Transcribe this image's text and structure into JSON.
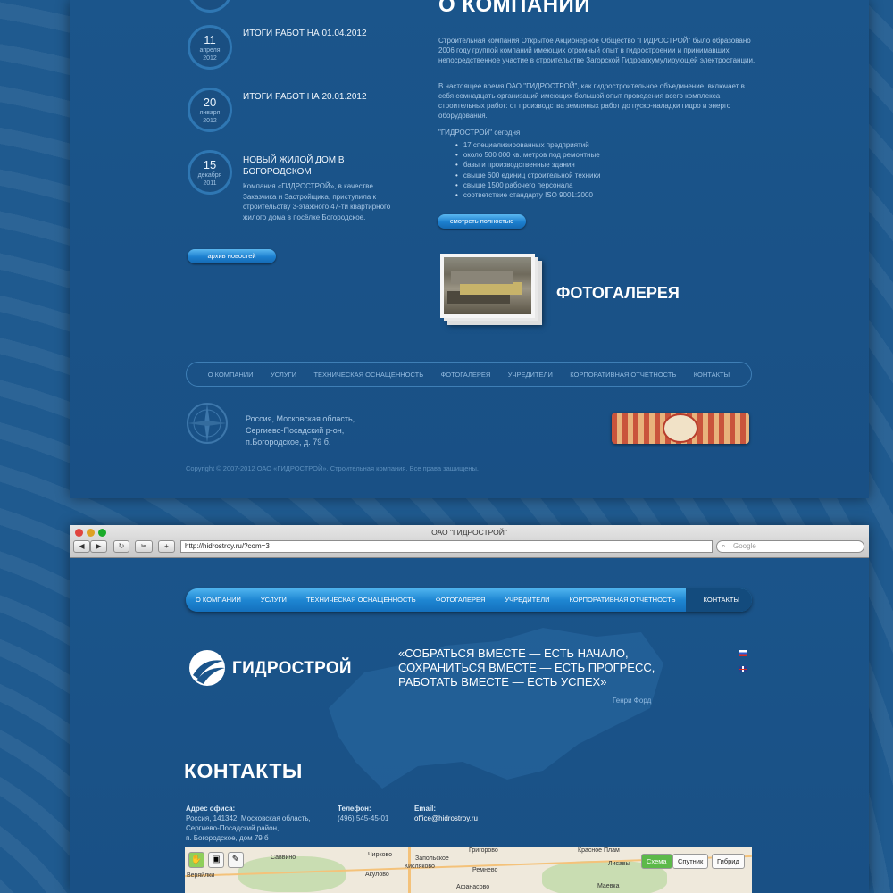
{
  "news": [
    {
      "day": "11",
      "month": "апреля",
      "year": "2012",
      "title": "ИТОГИ РАБОТ НА 01.04.2012",
      "text": ""
    },
    {
      "day": "20",
      "month": "января",
      "year": "2012",
      "title": "ИТОГИ РАБОТ НА 20.01.2012",
      "text": ""
    },
    {
      "day": "15",
      "month": "декабря",
      "year": "2011",
      "title": "НОВЫЙ ЖИЛОЙ ДОМ В БОГОРОДСКОМ",
      "text": "Компания «ГИДРОСТРОЙ», в качестве Заказчика и Застройщика, приступила к строительству 3-этажного 47-ти квартирного жилого дома в посёлке Богородское."
    }
  ],
  "news_archive_button": "архив новостей",
  "about": {
    "title": "О КОМПАНИИ",
    "p1": "Строительная компания Открытое Акционерное Общество \"ГИДРОСТРОЙ\" было образовано 2006 году группой компаний имеющих огромный опыт в гидростроении и принимавших непосредственное участие в строительстве Загорской Гидроаккумулирующей электростанции.",
    "p2": "В настоящее время ОАО \"ГИДРОСТРОЙ\", как гидростроительное объединение, включает в себя семнадцать организаций имеющих большой опыт проведения всего комплекса строительных работ: от производства земляных работ до пуско-наладки гидро и энерго оборудования.",
    "today": "\"ГИДРОСТРОЙ\" сегодня",
    "list": [
      "17 специализированных предприятий",
      "около 500 000 кв. метров под ремонтные",
      "базы и производственные здания",
      "свыше 600 единиц строительной техники",
      "свыше 1500 рабочего персонала",
      "соответствие стандарту ISO 9001:2000"
    ],
    "more_button": "смотреть полностью"
  },
  "gallery_label": "ФОТОГАЛЕРЕЯ",
  "footer_nav": [
    "О КОМПАНИИ",
    "УСЛУГИ",
    "ТЕХНИЧЕСКАЯ ОСНАЩЕННОСТЬ",
    "ФОТОГАЛЕРЕЯ",
    "УЧРЕДИТЕЛИ",
    "КОРПОРАТИВНАЯ ОТЧЕТНОСТЬ",
    "КОНТАКТЫ"
  ],
  "footer_address": [
    "Россия, Московская область,",
    "Сергиево-Посадский р-он,",
    "п.Богородское, д. 79 б."
  ],
  "copyright": "Copyright © 2007-2012 ОАО «ГИДРОСТРОЙ». Строительная компания. Все права защищены.",
  "browser": {
    "title": "ОАО \"ГИДРОСТРОЙ\"",
    "url": "http://hidrostroy.ru/?com=3",
    "search_placeholder": "Google"
  },
  "site_nav": [
    "О КОМПАНИИ",
    "УСЛУГИ",
    "ТЕХНИЧЕСКАЯ ОСНАЩЕННОСТЬ",
    "ФОТОГАЛЕРЕЯ",
    "УЧРЕДИТЕЛИ",
    "КОРПОРАТИВНАЯ ОТЧЕТНОСТЬ",
    "КОНТАКТЫ"
  ],
  "logo_text": "ГИДРОСТРОЙ",
  "quote": [
    "«СОБРАТЬСЯ ВМЕСТЕ — ЕСТЬ НАЧАЛО,",
    "СОХРАНИТЬСЯ ВМЕСТЕ — ЕСТЬ ПРОГРЕСС,",
    "РАБОТАТЬ ВМЕСТЕ — ЕСТЬ УСПЕХ»"
  ],
  "quote_author": "Генри Форд",
  "contacts": {
    "title": "КОНТАКТЫ",
    "address_label": "Адрес офиса:",
    "address_lines": [
      "Россия, 141342, Московская область,",
      "Сергиево-Посадский район,",
      "п. Богородское, дом 79 б"
    ],
    "phone_label": "Телефон:",
    "phone": "(496) 545-45-01",
    "email_label": "Email:",
    "email": "office@hidrostroy.ru"
  },
  "map": {
    "labels": [
      "Веряйлки",
      "Саввино",
      "Чирково",
      "Акулово",
      "Запольское",
      "Кисляково",
      "Григорово",
      "Ремнево",
      "Красное Плам",
      "Лисавы",
      "Маевка",
      "Афанасово"
    ],
    "types": [
      "Схема",
      "Спутник",
      "Гибрид"
    ],
    "active_type": "Схема"
  },
  "colors": {
    "accent": "#1e86d2",
    "background": "#1b558b"
  }
}
